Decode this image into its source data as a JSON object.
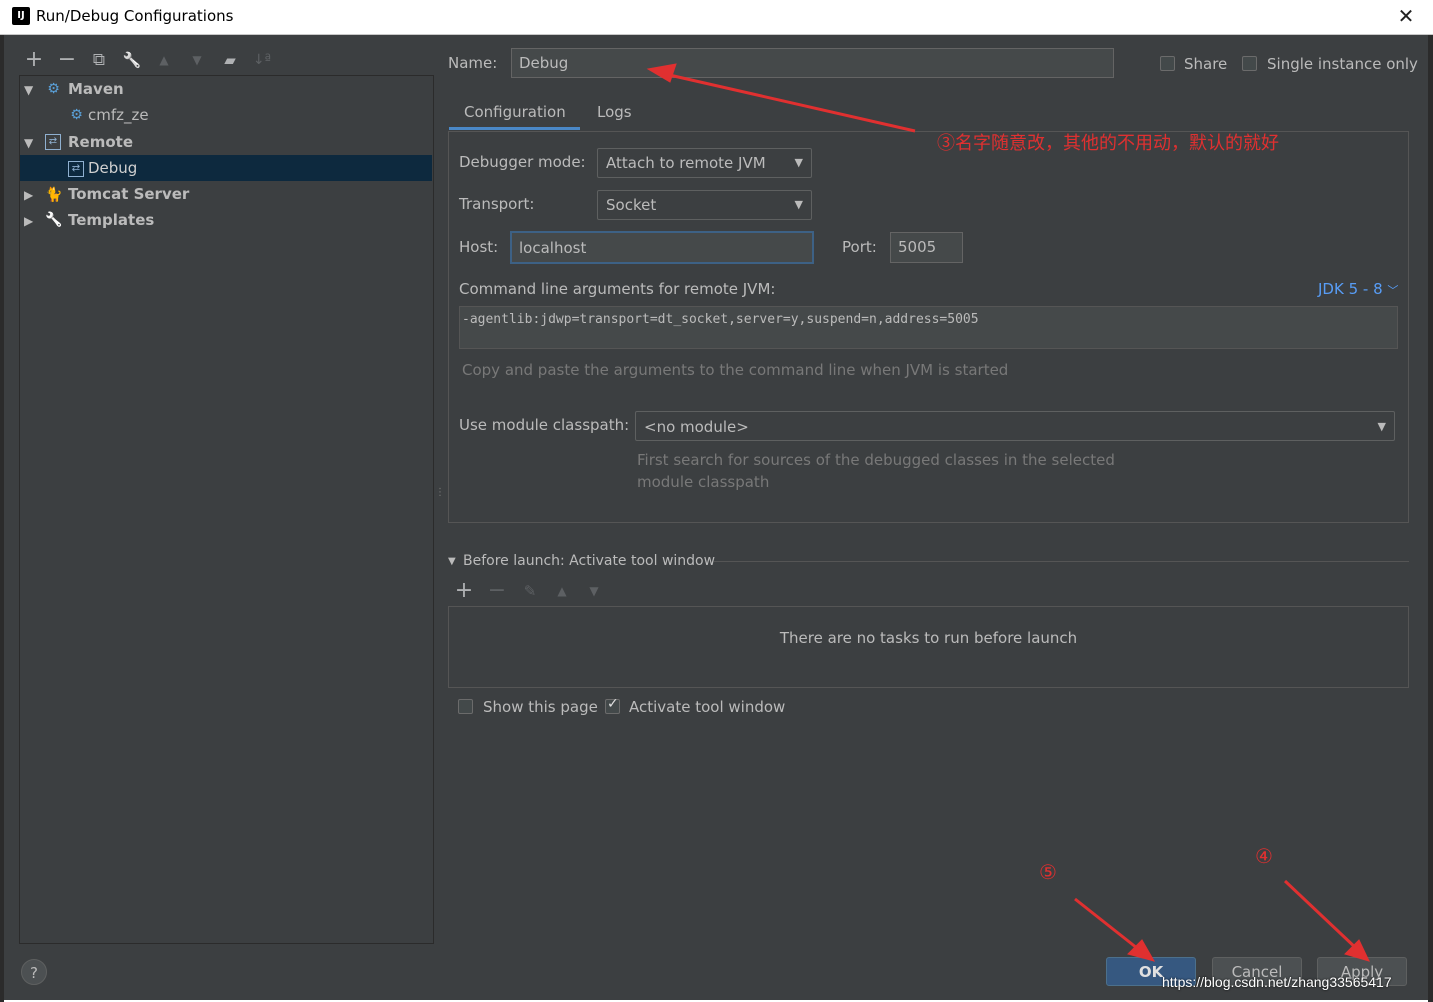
{
  "window": {
    "title": "Run/Debug Configurations",
    "close": "✕",
    "app_icon": "IJ"
  },
  "toolbar": {
    "add": "+",
    "remove": "−",
    "copy": "⧉",
    "edit": "🔧",
    "up": "▲",
    "down": "▼",
    "folder": "▰",
    "sort": "↓ª"
  },
  "tree": {
    "maven": "Maven",
    "maven_child": "cmfz_ze",
    "remote": "Remote",
    "remote_child": "Debug",
    "tomcat": "Tomcat Server",
    "templates": "Templates"
  },
  "name_field": {
    "label": "Name:",
    "value": "Debug"
  },
  "share": {
    "label": "Share",
    "checked": false
  },
  "single_instance": {
    "label": "Single instance only",
    "checked": false
  },
  "tabs": [
    "Configuration",
    "Logs"
  ],
  "config": {
    "debugger_mode_label": "Debugger mode:",
    "debugger_mode_value": "Attach to remote JVM",
    "transport_label": "Transport:",
    "transport_value": "Socket",
    "host_label": "Host:",
    "host_value": "localhost",
    "port_label": "Port:",
    "port_value": "5005",
    "cmd_label": "Command line arguments for remote JVM:",
    "jdk_link": "JDK 5 - 8",
    "cmd_value": "-agentlib:jdwp=transport=dt_socket,server=y,suspend=n,address=5005",
    "cmd_hint": "Copy and paste the arguments to the command line when JVM is started",
    "module_label": "Use module classpath:",
    "module_value": "<no module>",
    "module_hint_1": "First search for sources of the debugged classes in the selected",
    "module_hint_2": "module classpath"
  },
  "before_launch": {
    "title": "Before launch: Activate tool window",
    "empty": "There are no tasks to run before launch"
  },
  "show_page": {
    "label": "Show this page",
    "checked": false
  },
  "activate_tool": {
    "label": "Activate tool window",
    "checked": true
  },
  "buttons": {
    "ok": "OK",
    "cancel": "Cancel",
    "apply": "Apply",
    "help": "?"
  },
  "annotations": {
    "note3": "③名字随意改，其他的不用动，默认的就好",
    "note4": "④",
    "note5": "⑤",
    "watermark": "https://blog.csdn.net/zhang33565417"
  },
  "colors": {
    "accent_red": "#e03030",
    "selection": "#0d293e",
    "link": "#589df6",
    "ok_button": "#365880"
  }
}
